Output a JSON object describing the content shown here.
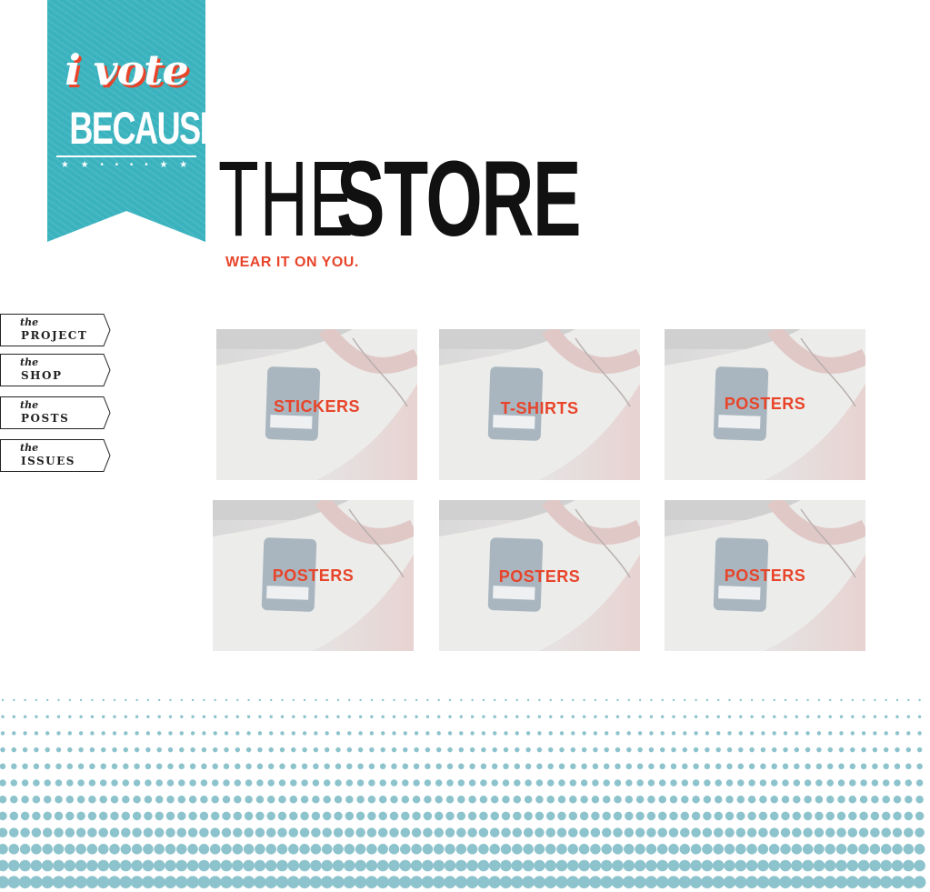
{
  "logo": {
    "line1": "i vote",
    "line2": "BECAUSE",
    "stars": "★ ★ • • • • ★ ★",
    "color": "#3bb3bf"
  },
  "header": {
    "title_the": "THE",
    "title_store": "STORE",
    "subtitle": "WEAR IT ON YOU."
  },
  "nav": {
    "items": [
      {
        "the": "the",
        "label": "PROJECT"
      },
      {
        "the": "the",
        "label": "SHOP"
      },
      {
        "the": "the",
        "label": "POSTS"
      },
      {
        "the": "the",
        "label": "ISSUES"
      }
    ]
  },
  "products": [
    {
      "label": "STICKERS"
    },
    {
      "label": "T-SHIRTS"
    },
    {
      "label": "POSTERS"
    },
    {
      "label": "POSTERS"
    },
    {
      "label": "POSTERS"
    },
    {
      "label": "POSTERS"
    }
  ],
  "colors": {
    "accent": "#e8442a",
    "teal": "#3bb3bf",
    "dots": "#8dc3cc"
  }
}
